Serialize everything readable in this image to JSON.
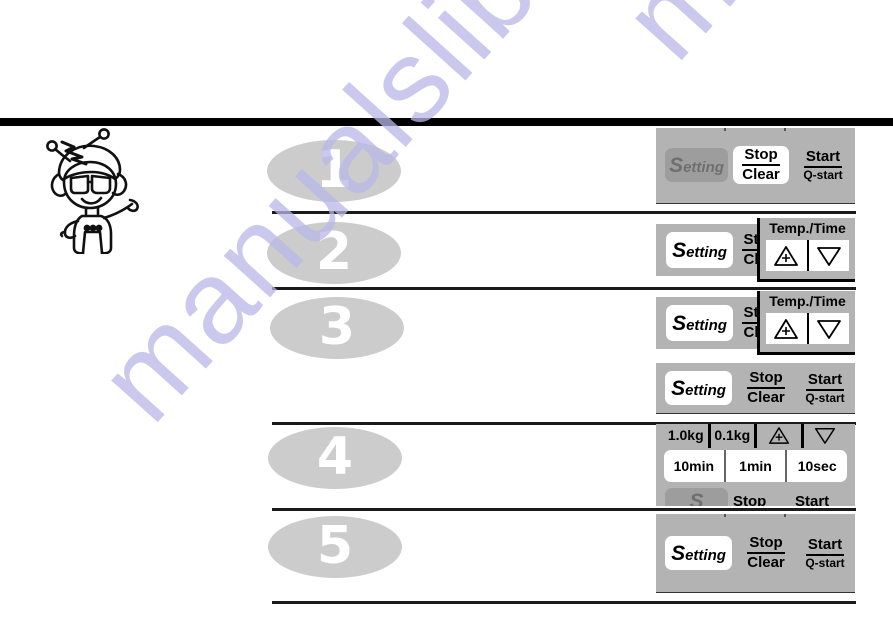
{
  "page": {
    "watermark_text": "manualslib.com",
    "watermark_color": "#b9b8e8",
    "background": "#ffffff",
    "rule_color": "#000000",
    "badge_fill": "#cccccc",
    "badge_text_color": "#ffffff",
    "panel_gray": "#b3b3b3",
    "key_white": "#ffffff",
    "key_dim": "#9d9d9d"
  },
  "mascot": {
    "name": "robot-mascot-character",
    "description": "cartoon robot character with antennae, goggles and waving arm"
  },
  "steps": [
    {
      "number": "1"
    },
    {
      "number": "2"
    },
    {
      "number": "3"
    },
    {
      "number": "4"
    },
    {
      "number": "5"
    }
  ],
  "panels": [
    {
      "id": "panel-1",
      "keys": {
        "setting": "Setting",
        "setting_cap": "S",
        "setting_rest": "etting",
        "stop": "Stop",
        "clear": "Clear",
        "start": "Start",
        "qstart": "Q-start"
      }
    },
    {
      "id": "panel-2",
      "keys": {
        "setting_cap": "S",
        "setting_rest": "etting",
        "stop_partial": "St",
        "clear_partial": "Cl"
      },
      "temp_time": {
        "caption": "Temp./Time",
        "up_icon": "triangle-up-plus-icon",
        "down_icon": "triangle-down-icon"
      }
    },
    {
      "id": "panel-3a",
      "keys": {
        "setting_cap": "S",
        "setting_rest": "etting",
        "stop_partial": "St",
        "clear_partial": "Cl"
      },
      "temp_time": {
        "caption": "Temp./Time",
        "up_icon": "triangle-up-plus-icon",
        "down_icon": "triangle-down-icon"
      }
    },
    {
      "id": "panel-3b",
      "keys": {
        "setting_cap": "S",
        "setting_rest": "etting",
        "stop": "Stop",
        "clear": "Clear",
        "start": "Start",
        "qstart": "Q-start"
      }
    },
    {
      "id": "panel-4",
      "weight_row": [
        "1.0kg",
        "0.1kg"
      ],
      "arrow_icons": [
        "triangle-up-plus-icon",
        "triangle-down-icon"
      ],
      "time_row": [
        "10min",
        "1min",
        "10sec"
      ],
      "bottom_keys": {
        "setting_cap": "S",
        "stop": "Stop",
        "start": "Start"
      }
    },
    {
      "id": "panel-5",
      "keys": {
        "setting_cap": "S",
        "setting_rest": "etting",
        "stop": "Stop",
        "clear": "Clear",
        "start": "Start",
        "qstart": "Q-start"
      }
    }
  ]
}
